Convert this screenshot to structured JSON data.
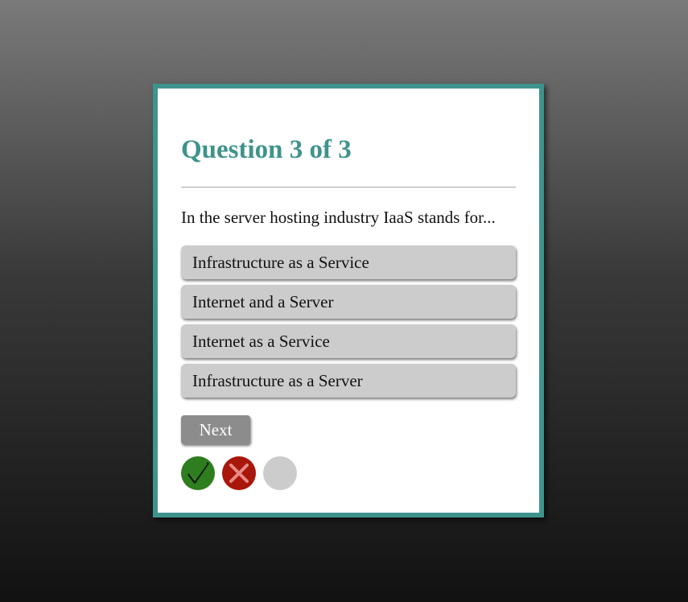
{
  "quiz": {
    "title": "Question 3 of 3",
    "question": "In the server hosting industry IaaS stands for...",
    "answers": [
      "Infrastructure as a Service",
      "Internet and a Server",
      "Internet as a Service",
      "Infrastructure as a Server"
    ],
    "next_label": "Next",
    "progress": [
      {
        "status": "correct",
        "icon": "checkmark-icon",
        "color": "#2e7d1f"
      },
      {
        "status": "incorrect",
        "icon": "cross-icon",
        "color": "#a8160c"
      },
      {
        "status": "unanswered",
        "icon": "",
        "color": "#cccccc"
      }
    ]
  },
  "colors": {
    "accent": "#3f938d",
    "option_bg": "#cccccc",
    "button_bg": "#8c8c8c"
  }
}
